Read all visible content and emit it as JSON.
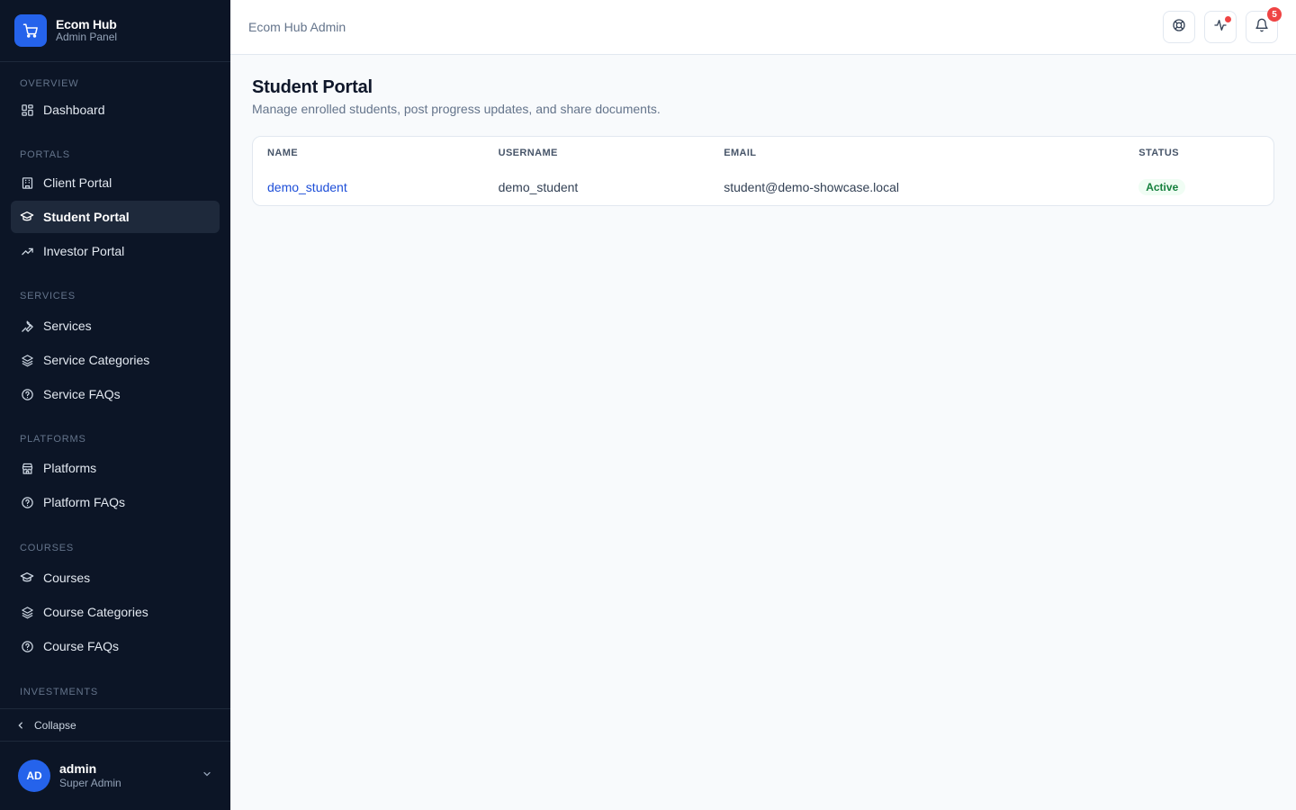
{
  "brand": {
    "name": "Ecom Hub",
    "subtitle": "Admin Panel",
    "icon": "cart-icon"
  },
  "sidebar": {
    "sections": [
      {
        "title": "OVERVIEW",
        "items": [
          {
            "label": "Dashboard",
            "icon": "grid-icon"
          }
        ]
      },
      {
        "title": "PORTALS",
        "items": [
          {
            "label": "Client Portal",
            "icon": "building-icon"
          },
          {
            "label": "Student Portal",
            "icon": "graduation-cap-icon",
            "active": true
          },
          {
            "label": "Investor Portal",
            "icon": "trending-up-icon"
          }
        ]
      },
      {
        "title": "SERVICES",
        "items": [
          {
            "label": "Services",
            "icon": "wrench-icon"
          },
          {
            "label": "Service Categories",
            "icon": "layers-icon"
          },
          {
            "label": "Service FAQs",
            "icon": "help-circle-icon"
          }
        ]
      },
      {
        "title": "PLATFORMS",
        "items": [
          {
            "label": "Platforms",
            "icon": "store-icon"
          },
          {
            "label": "Platform FAQs",
            "icon": "help-circle-icon"
          }
        ]
      },
      {
        "title": "COURSES",
        "items": [
          {
            "label": "Courses",
            "icon": "graduation-cap-icon"
          },
          {
            "label": "Course Categories",
            "icon": "layers-icon"
          },
          {
            "label": "Course FAQs",
            "icon": "help-circle-icon"
          }
        ]
      },
      {
        "title": "INVESTMENTS",
        "items": []
      }
    ],
    "collapse_label": "Collapse"
  },
  "user": {
    "initials": "AD",
    "name": "admin",
    "role": "Super Admin"
  },
  "header": {
    "title": "Ecom Hub Admin",
    "notifications_count": "5"
  },
  "main": {
    "title": "Student Portal",
    "description": "Manage enrolled students, post progress updates, and share documents.",
    "table": {
      "columns": [
        "NAME",
        "USERNAME",
        "EMAIL",
        "STATUS"
      ],
      "rows": [
        {
          "name": "demo_student",
          "username": "demo_student",
          "email": "student@demo-showcase.local",
          "status": "Active"
        }
      ]
    }
  },
  "colors": {
    "sidebar_bg": "#0c1526",
    "accent": "#2563eb",
    "link": "#1d4ed8",
    "status_active": "#15803d",
    "badge": "#ef4444"
  }
}
